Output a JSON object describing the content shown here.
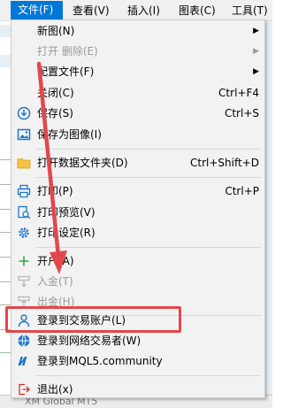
{
  "menubar": {
    "file": "文件(F)",
    "view": "查看(V)",
    "insert": "插入(I)",
    "chart": "图表(C)",
    "tools": "工具(T)"
  },
  "file_menu": {
    "new_chart": "新图(N)",
    "open_deleted": "打开 删除(E)",
    "profiles": "配置文件(F)",
    "close": "关闭(C)",
    "close_shortcut": "Ctrl+F4",
    "save": "保存(S)",
    "save_shortcut": "Ctrl+S",
    "save_as_picture": "保存为图像(I)",
    "open_data_folder": "打开数据文件夹(D)",
    "open_data_folder_shortcut": "Ctrl+Shift+D",
    "print": "打印(P)",
    "print_shortcut": "Ctrl+P",
    "print_preview": "打印预览(V)",
    "print_setup": "打印设定(R)",
    "open_account": "开户(A)",
    "deposit": "入金(T)",
    "withdraw": "出金(H)",
    "login_trade_account": "登录到交易账户(L)",
    "login_web_trader": "登录到网络交易者(W)",
    "login_mql5": "登录到MQL5.community",
    "exit": "退出(x)"
  },
  "background": {
    "status_text": "XM Global MT5"
  },
  "colors": {
    "menu_highlight": "#0078d7",
    "annotation_red": "#e2474b",
    "icon_blue": "#1e78c8",
    "icon_green": "#2ea84a",
    "folder_yellow": "#f5c342"
  }
}
